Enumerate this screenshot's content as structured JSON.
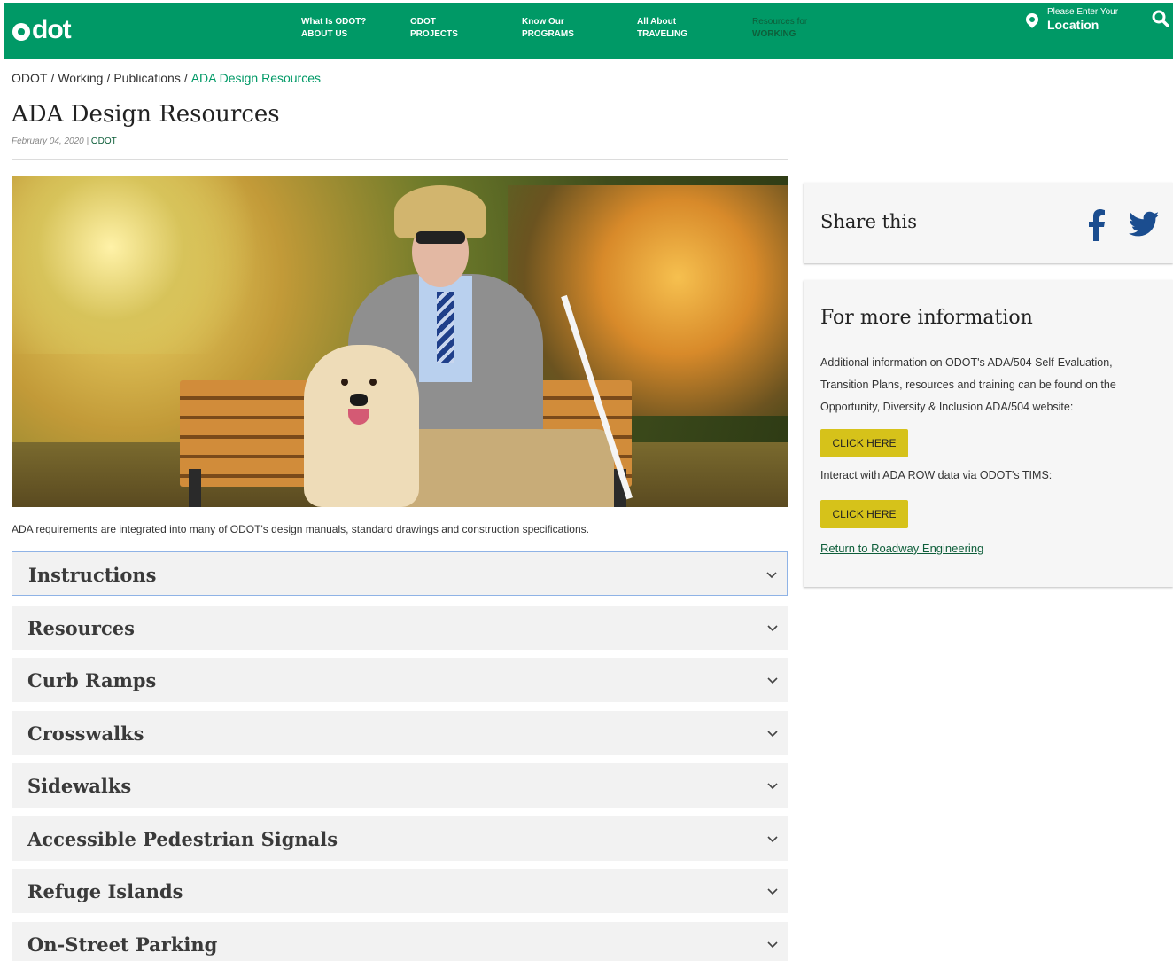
{
  "header": {
    "logo": "odot",
    "nav": [
      {
        "line1": "What Is ODOT?",
        "line2": "ABOUT US"
      },
      {
        "line1": "ODOT",
        "line2": "PROJECTS"
      },
      {
        "line1": "Know Our",
        "line2": "PROGRAMS"
      },
      {
        "line1": "All About",
        "line2": "TRAVELING"
      },
      {
        "line1": "Resources for",
        "line2": "WORKING"
      }
    ],
    "location_prompt": "Please Enter Your",
    "location_label": "Location",
    "colors": {
      "brand_green": "#009966",
      "active_nav": "#0e5e3a"
    }
  },
  "breadcrumb": {
    "items": [
      "ODOT",
      "Working",
      "Publications"
    ],
    "current": "ADA Design Resources",
    "separator": "/"
  },
  "page": {
    "title": "ADA Design Resources",
    "date": "February 04, 2020",
    "author": "ODOT",
    "caption": "ADA requirements are integrated into many of ODOT's design manuals, standard drawings and construction specifications."
  },
  "accordion": [
    "Instructions",
    "Resources",
    "Curb Ramps",
    "Crosswalks",
    "Sidewalks",
    "Accessible Pedestrian Signals",
    "Refuge Islands",
    "On-Street Parking"
  ],
  "sidebar": {
    "share_title": "Share this",
    "info_title": "For more information",
    "info_text": "Additional information on ODOT's ADA/504 Self-Evaluation, Transition Plans, resources and training can be found on the Opportunity, Diversity & Inclusion ADA/504 website:",
    "button1": "CLICK HERE",
    "info_text2": "Interact with ADA ROW data via ODOT's TIMS:",
    "button2": "CLICK HERE",
    "return_link": "Return to Roadway Engineering",
    "button_color": "#d6c21a"
  }
}
